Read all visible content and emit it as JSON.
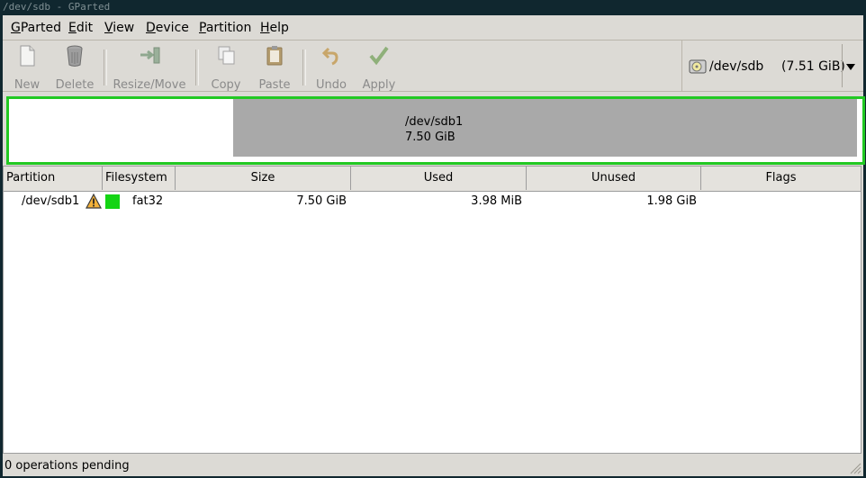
{
  "window": {
    "title": "/dev/sdb - GParted"
  },
  "menubar": {
    "items": [
      {
        "label": "GParted",
        "mnemonic": "G",
        "rest": "Parted"
      },
      {
        "label": "Edit",
        "mnemonic": "E",
        "rest": "dit"
      },
      {
        "label": "View",
        "mnemonic": "V",
        "rest": "iew"
      },
      {
        "label": "Device",
        "mnemonic": "D",
        "rest": "evice"
      },
      {
        "label": "Partition",
        "mnemonic": "P",
        "rest": "artition"
      },
      {
        "label": "Help",
        "mnemonic": "H",
        "rest": "elp"
      }
    ]
  },
  "toolbar": {
    "new_label": "New",
    "delete_label": "Delete",
    "resize_label": "Resize/Move",
    "copy_label": "Copy",
    "paste_label": "Paste",
    "undo_label": "Undo",
    "apply_label": "Apply"
  },
  "device_selector": {
    "device": "/dev/sdb",
    "size": "(7.51 GiB)"
  },
  "disk_map": {
    "partition_name": "/dev/sdb1",
    "partition_size": "7.50 GiB"
  },
  "table": {
    "headers": {
      "partition": "Partition",
      "filesystem": "Filesystem",
      "size": "Size",
      "used": "Used",
      "unused": "Unused",
      "flags": "Flags"
    },
    "rows": [
      {
        "partition": "/dev/sdb1",
        "filesystem": "fat32",
        "size": "7.50 GiB",
        "used": "3.98 MiB",
        "unused": "1.98 GiB",
        "flags": ""
      }
    ]
  },
  "colors": {
    "fat32": "#13d413",
    "selection_border": "#22c922",
    "used_space": "#a9a9a9"
  },
  "statusbar": {
    "text": "0 operations pending"
  }
}
